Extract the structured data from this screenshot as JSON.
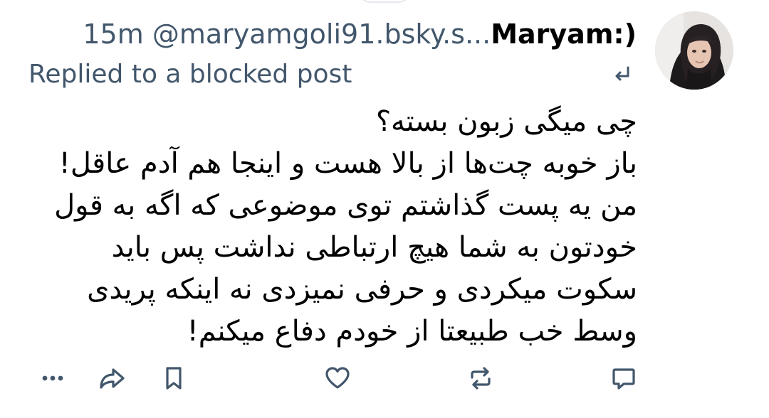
{
  "post": {
    "author_display_name": "Maryam:)",
    "author_handle": "@maryamgoli91.bsky.s...",
    "time_ago": "15m",
    "reply_context": "Replied to a blocked post",
    "body_lines": [
      "چی میگی زبون بسته؟",
      "باز خوبه چت‌ها از بالا هست و اینجا هم آدم عاقل!",
      "من یه پست گذاشتم توی موضوعی که اگه به قول",
      "خودتون به شما هیچ ارتباطی نداشت پس باید",
      "سکوت میکردی و حرفی نمیزدی نه اینکه پریدی",
      "وسط خب طبیعتا از خودم دفاع میکنم!"
    ]
  },
  "actions": [
    {
      "name": "reply",
      "icon": "speech-bubble-icon"
    },
    {
      "name": "repost",
      "icon": "repost-icon"
    },
    {
      "name": "like",
      "icon": "heart-icon"
    },
    {
      "name": "bookmark",
      "icon": "bookmark-icon"
    },
    {
      "name": "share",
      "icon": "share-arrow-icon"
    },
    {
      "name": "more",
      "icon": "ellipsis-icon"
    }
  ],
  "colors": {
    "muted_text": "#42576c",
    "icon": "#42576c",
    "text": "#000000",
    "background": "#ffffff"
  }
}
